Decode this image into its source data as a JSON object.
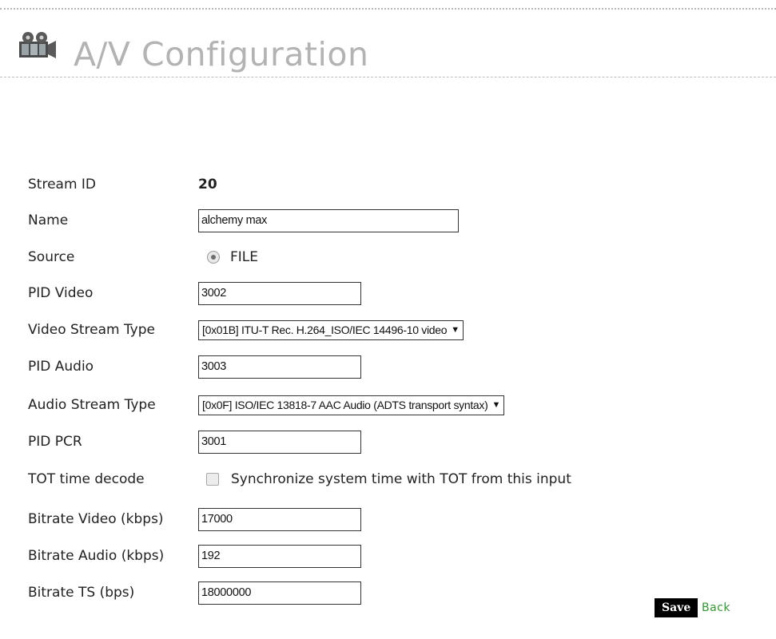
{
  "header": {
    "title": "A/V Configuration",
    "icon": "film-reel-icon"
  },
  "form": {
    "stream_id": {
      "label": "Stream ID",
      "value": "20"
    },
    "name": {
      "label": "Name",
      "value": "alchemy max"
    },
    "source": {
      "label": "Source",
      "option": "FILE",
      "selected": true
    },
    "pid_video": {
      "label": "PID Video",
      "value": "3002"
    },
    "video_stream_type": {
      "label": "Video Stream Type",
      "selected": "[0x01B] ITU-T Rec. H.264_ISO/IEC 14496-10 video"
    },
    "pid_audio": {
      "label": "PID Audio",
      "value": "3003"
    },
    "audio_stream_type": {
      "label": "Audio Stream Type",
      "selected": "[0x0F] ISO/IEC 13818-7 AAC Audio (ADTS transport syntax)"
    },
    "pid_pcr": {
      "label": "PID PCR",
      "value": "3001"
    },
    "tot_time_decode": {
      "label": "TOT time decode",
      "checkbox_label": "Synchronize system time with TOT from this input",
      "checked": false
    },
    "bitrate_video": {
      "label": "Bitrate Video (kbps)",
      "value": "17000"
    },
    "bitrate_audio": {
      "label": "Bitrate Audio (kbps)",
      "value": "192"
    },
    "bitrate_ts": {
      "label": "Bitrate TS (bps)",
      "value": "18000000"
    }
  },
  "actions": {
    "save_label": "Save",
    "back_label": "Back"
  },
  "colors": {
    "title": "#b3b3b3",
    "back_link": "#2e9a2e",
    "save_bg": "#000000"
  }
}
